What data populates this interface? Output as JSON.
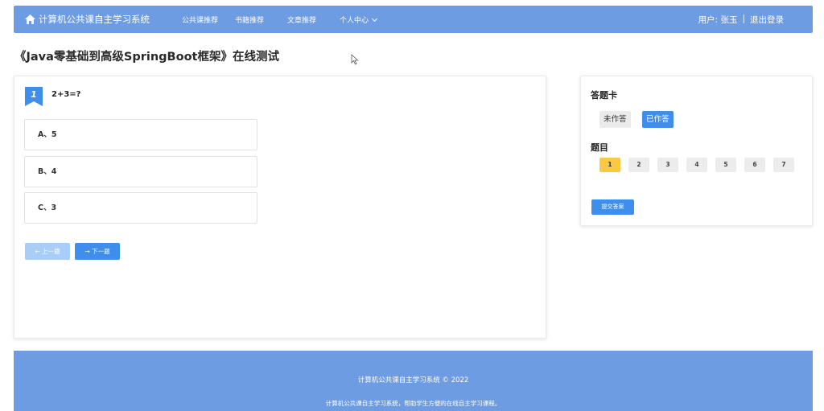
{
  "navbar": {
    "brand": "计算机公共课自主学习系统",
    "items": [
      "公共课推荐",
      "书籍推荐",
      "文章推荐",
      "个人中心"
    ],
    "user": "用户: 张玉",
    "separator": "|",
    "logout": "退出登录"
  },
  "page": {
    "title": "《Java零基础到高级SpringBoot框架》在线测试"
  },
  "question": {
    "number": "1",
    "text": "2+3=?",
    "options": [
      "A、5",
      "B、4",
      "C、3"
    ],
    "prev_label": "← 上一题",
    "next_label": "→ 下一题"
  },
  "answer_sheet": {
    "title": "答题卡",
    "legend_unanswered": "未作答",
    "legend_answered": "已作答",
    "list_title": "题目",
    "question_numbers": [
      "1",
      "2",
      "3",
      "4",
      "5",
      "6",
      "7"
    ],
    "current": "1",
    "submit_label": "提交答案"
  },
  "footer": {
    "copyright": "计算机公共课自主学习系统 © 2022",
    "description": "计算机公共课自主学习系统，帮助学生方便的在线自主学习课程。"
  },
  "colors": {
    "navbar": "#6e9ce3",
    "primary": "#3f8eec",
    "current_question": "#f9c845"
  }
}
